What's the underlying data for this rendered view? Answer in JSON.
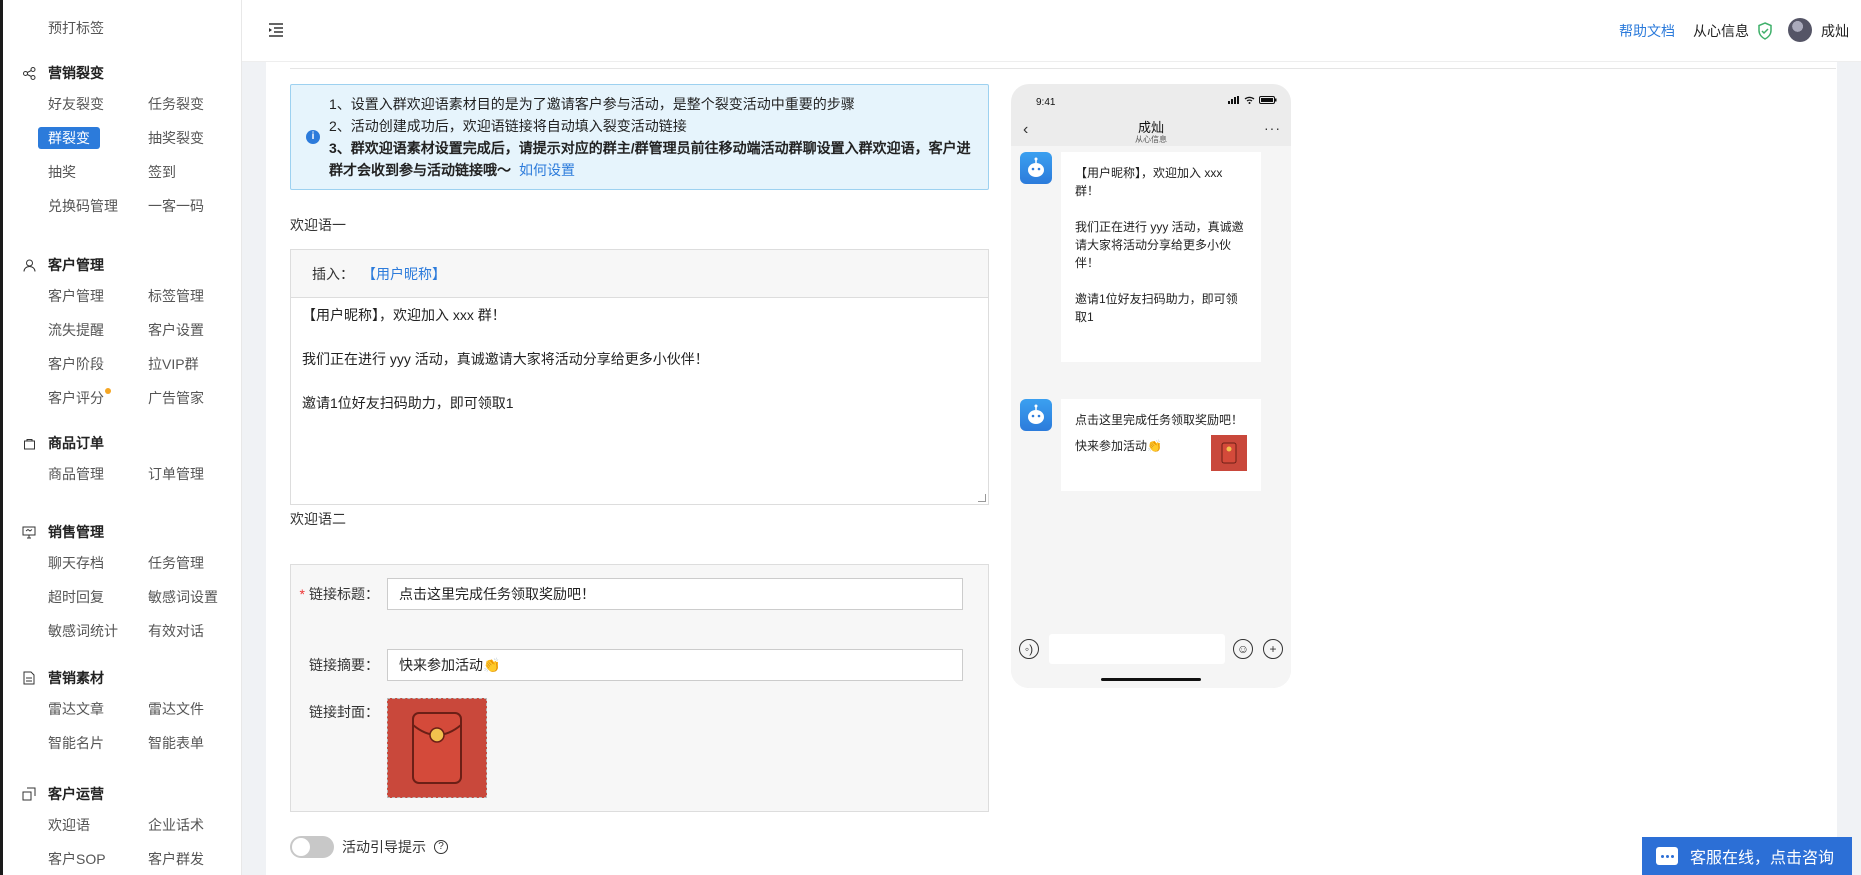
{
  "sidebar": {
    "cut_items": [
      "",
      ""
    ],
    "top_item": "预打标签",
    "groups": [
      {
        "title": "营销裂变",
        "icon": "share-icon",
        "items": [
          "好友裂变",
          "任务裂变",
          "群裂变",
          "抽奖裂变",
          "抽奖",
          "签到",
          "兑换码管理",
          "一客一码"
        ]
      },
      {
        "title": "客户管理",
        "icon": "user-icon",
        "items": [
          "客户管理",
          "标签管理",
          "流失提醒",
          "客户设置",
          "客户阶段",
          "拉VIP群",
          "客户评分",
          "广告管家"
        ]
      },
      {
        "title": "商品订单",
        "icon": "shopping-bag-icon",
        "items": [
          "商品管理",
          "订单管理"
        ]
      },
      {
        "title": "销售管理",
        "icon": "monitor-chat-icon",
        "items": [
          "聊天存档",
          "任务管理",
          "超时回复",
          "敏感词设置",
          "敏感词统计",
          "有效对话"
        ]
      },
      {
        "title": "营销素材",
        "icon": "document-icon",
        "items": [
          "雷达文章",
          "雷达文件",
          "智能名片",
          "智能表单"
        ]
      },
      {
        "title": "客户运营",
        "icon": "operation-icon",
        "items": [
          "欢迎语",
          "企业话术",
          "客户SOP",
          "客户群发"
        ]
      }
    ],
    "active_item": "群裂变"
  },
  "header": {
    "help_label": "帮助文档",
    "company_name": "从心信息",
    "user_name": "成灿"
  },
  "info": {
    "line1": "1、设置入群欢迎语素材目的是为了邀请客户参与活动，是整个裂变活动中重要的步骤",
    "line2": "2、活动创建成功后，欢迎语链接将自动填入裂变活动链接",
    "line3": "3、群欢迎语素材设置完成后，请提示对应的群主/群管理员前往移动端活动群聊设置入群欢迎语，客户进群才会收到参与活动链接哦～",
    "link": "如何设置"
  },
  "welcome1": {
    "label": "欢迎语一",
    "insert_label": "插入：",
    "insert_button": "【用户昵称】",
    "text": "【用户昵称】，欢迎加入 xxx 群！\n\n我们正在进行 yyy 活动，真诚邀请大家将活动分享给更多小伙伴！\n\n邀请1位好友扫码助力，即可领取1"
  },
  "welcome2": {
    "label": "欢迎语二",
    "title_label": "链接标题：",
    "title_value": "点击这里完成任务领取奖励吧！",
    "summary_label": "链接摘要：",
    "summary_value": "快来参加活动👏",
    "cover_label": "链接封面："
  },
  "guide_toggle": {
    "label": "活动引导提示",
    "on": false
  },
  "phone": {
    "time": "9:41",
    "title": "成灿",
    "subtitle": "从心信息",
    "msg1": "【用户昵称】，欢迎加入 xxx 群！\n\n我们正在进行 yyy 活动，真诚邀请大家将活动分享给更多小伙伴！\n\n邀请1位好友扫码助力，即可领取1",
    "card_title": "点击这里完成任务领取奖励吧！",
    "card_desc": "快来参加活动👏"
  },
  "cs_float": {
    "label": "客服在线，点击咨询"
  },
  "colors": {
    "accent": "#2c7bdb",
    "info_bg": "#e6f4fc",
    "red_packet": "#c9483b"
  }
}
